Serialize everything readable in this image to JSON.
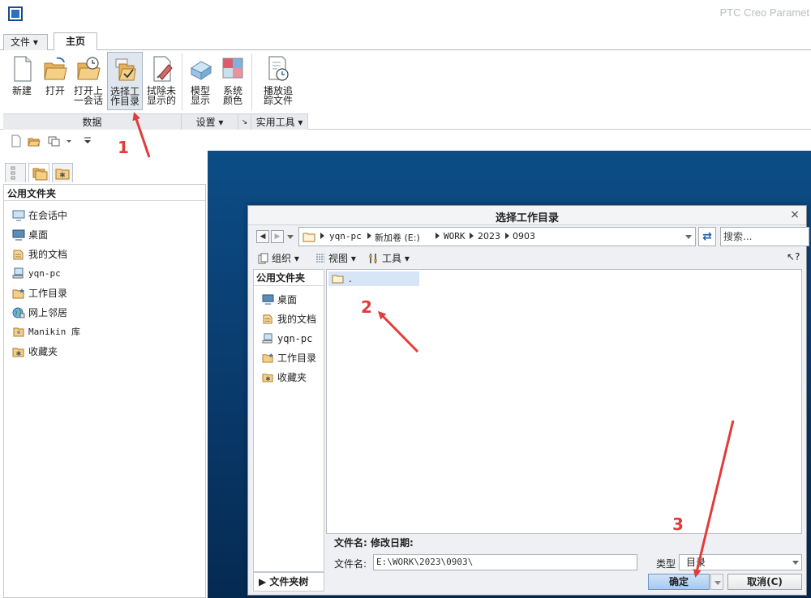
{
  "app": {
    "title": "PTC Creo Paramet"
  },
  "ribbon": {
    "tabs": [
      {
        "label": "文件 ▾"
      },
      {
        "label": "主页"
      }
    ],
    "buttons": {
      "new": "新建",
      "open": "打开",
      "open_last": "打开上\n一会话",
      "select_workdir": "选择工\n作目录",
      "erase": "拭除未\n显示的",
      "model_display": "模型\n显示",
      "system_colors": "系统\n颜色",
      "trail": "播放追\n踪文件"
    },
    "groups": {
      "data": "数据",
      "settings": "设置 ▾",
      "utilities": "实用工具 ▾"
    }
  },
  "navigator": {
    "header": "公用文件夹",
    "items": [
      {
        "label": "在会话中"
      },
      {
        "label": "桌面"
      },
      {
        "label": "我的文档"
      },
      {
        "label": "yqn-pc"
      },
      {
        "label": "工作目录"
      },
      {
        "label": "网上邻居"
      },
      {
        "label": "Manikin 库"
      },
      {
        "label": "收藏夹"
      }
    ]
  },
  "dialog": {
    "title": "选择工作目录",
    "close": "×",
    "breadcrumb": [
      "yqn-pc",
      "新加卷 (E:)",
      "WORK",
      "2023",
      "0903"
    ],
    "search_placeholder": "搜索...",
    "toolbar": {
      "organize": "组织 ▾",
      "view": "视图 ▾",
      "tools": "工具 ▾",
      "help": "?"
    },
    "left_header": "公用文件夹",
    "left_items": [
      {
        "label": "桌面"
      },
      {
        "label": "我的文档"
      },
      {
        "label": "yqn-pc"
      },
      {
        "label": "工作目录"
      },
      {
        "label": "收藏夹"
      }
    ],
    "folder_tree": "▶  文件夹树",
    "file_entry": ".",
    "info": "文件名:   修改日期:",
    "filename_label": "文件名:",
    "filename_value": "E:\\WORK\\2023\\0903\\",
    "type_label": "类型",
    "type_value": "目录",
    "ok": "确定",
    "cancel": "取消(C)"
  },
  "annotations": [
    "1",
    "2",
    "3"
  ],
  "colors": {
    "annotation": "#e23b3b",
    "graphics_bg": "#0a3d70",
    "accent": "#1a5fa8"
  }
}
